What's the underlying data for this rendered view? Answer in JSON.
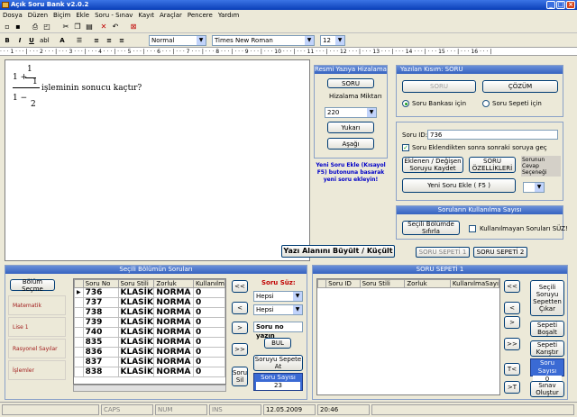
{
  "window": {
    "title": "Açık Soru Bank v2.0.2",
    "min": "_",
    "max": "□",
    "close": "×"
  },
  "menu": [
    "Dosya",
    "Düzen",
    "Biçim",
    "Ekle",
    "Soru - Sınav",
    "Kayıt",
    "Araçlar",
    "Pencere",
    "Yardım"
  ],
  "format": {
    "style": "Normal",
    "font": "Times New Roman",
    "size": "12",
    "bold": "B",
    "italic": "I",
    "underline": "U",
    "strike": "abl"
  },
  "ruler": "· · · 1 · · · | · · · 2 · · · | · · · 3 · · · | · · · 4 · · · | · · · 5 · · · | · · · 6 · · · | · · · 7 · · · | · · · 8 · · · | · · · 9 · · · | · · · 10 · · · | · · · 11 · · · | · · · 12 · · · | · · · 13 · · · | · · · 14 · · · | · · · 15 · · · | · · · 16 · · · |",
  "editor": {
    "one": "1",
    "text": "işleminin sonucu kaçtır?",
    "num1": "1",
    "den1": "2",
    "minus": "1 −",
    "plus": "1 +"
  },
  "align_panel": {
    "title": "Resmi Yazıya Hizalama",
    "soru_btn": "SORU",
    "hiz_label": "Hizalama Miktarı",
    "hiz_value": "220",
    "up": "Yukarı",
    "down": "Aşağı"
  },
  "info_text": "Yeni Soru Ekle (Kısayol F5) butonuna basarak yeni soru ekleyin!",
  "kind_panel": {
    "title": "Yazılan Kısım: SORU",
    "soru": "SORU",
    "cozum": "ÇÖZÜM",
    "r1": "Soru Bankası için",
    "r2": "Soru Sepeti için"
  },
  "soru_panel": {
    "id_label": "Soru ID:",
    "id_value": "736",
    "chk_label": "Soru Eklendikten sonra sonraki soruya geç",
    "save": "Eklenen / Değişen Soruyu Kaydet",
    "props": "SORU ÖZELLİKLERİ",
    "answer": "Sorunun Cevap Seçeneği",
    "new": "Yeni Soru Ekle ( F5 )"
  },
  "sayi_panel": {
    "title": "Soruların Kullanılma Sayısı",
    "reset": "Seçili Bölümde Sıfırla",
    "chk": "Kullanılmayan Soruları SÜZ!"
  },
  "enlarge": "Yazı Alanını Büyült / Küçült",
  "basket_tabs": [
    "SORU SEPETİ 1",
    "SORU SEPETİ 2"
  ],
  "left_panel": {
    "title": "Seçili Bölümün Soruları",
    "section_btn": "Bölüm Seçme",
    "sections": [
      "Matematik",
      "Lise 1",
      "Rasyonel Sayılar",
      "İşlemler"
    ],
    "columns": [
      "Soru No",
      "Soru Stili",
      "Zorluk",
      "Kullanılm"
    ],
    "rows": [
      [
        "736",
        "KLASİK",
        "NORMA",
        "0"
      ],
      [
        "737",
        "KLASİK",
        "NORMA",
        "0"
      ],
      [
        "738",
        "KLASİK",
        "NORMA",
        "0"
      ],
      [
        "739",
        "KLASİK",
        "NORMA",
        "0"
      ],
      [
        "740",
        "KLASİK",
        "NORMA",
        "0"
      ],
      [
        "835",
        "KLASİK",
        "NORMA",
        "0"
      ],
      [
        "836",
        "KLASİK",
        "NORMA",
        "0"
      ],
      [
        "837",
        "KLASİK",
        "NORMA",
        "0"
      ],
      [
        "838",
        "KLASİK",
        "NORMA",
        "0"
      ]
    ]
  },
  "nav": [
    "<<",
    "<",
    ">",
    ">>"
  ],
  "filter": {
    "title": "Soru Süz:",
    "s1": "Hepsi",
    "s2": "Hepsi",
    "placeholder": "Soru no yazın",
    "find": "BUL",
    "add": "Soruyu Sepete At",
    "count_label": "Soru Sayısı",
    "count": "23",
    "del": "Soru Sil"
  },
  "basket": {
    "title": "SORU SEPETİ 1",
    "columns": [
      "Soru ID",
      "Soru Stili",
      "Zorluk",
      "KullanılmaSayı"
    ],
    "remove": "Seçili Soruyu Sepetten Çıkar",
    "empty": "Sepeti Boşalt",
    "shuffle": "Sepeti Karıştır",
    "count_label": "Soru Sayısı",
    "count": "0",
    "make": "Sınav Oluştur",
    "t1": "T<",
    "t2": ">T"
  },
  "status": {
    "caps": "CAPS",
    "num": "NUM",
    "ins": "INS",
    "date": "12.05.2009",
    "time": "20:46"
  }
}
